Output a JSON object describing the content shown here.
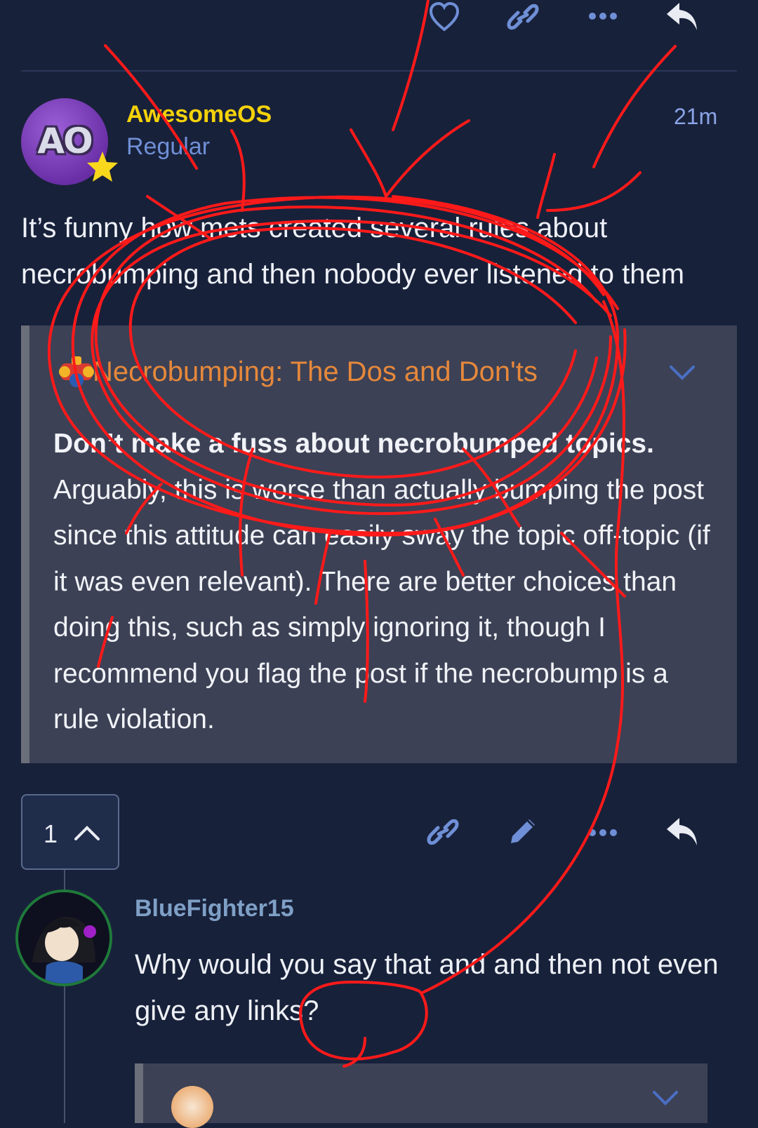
{
  "post": {
    "author": "AwesomeOS",
    "author_color": "#f4d20a",
    "avatar_initials": "AO",
    "role": "Regular",
    "time": "21m",
    "text": "It’s funny how mets created several rules about necrobumping and then nobody ever listened to them"
  },
  "quote": {
    "title": "Necrobumping: The Dos and Don'ts",
    "bold_line": "Don’t make a fuss about necrobumped topics.",
    "body": "Arguably, this is worse than actually bumping the post since this attitude can easily sway the topic off-topic (if it was even relevant). There are better choices than doing this, such as simply ignoring it, though I recommend you flag the post if the necrobump is a rule violation."
  },
  "post_actions": {
    "reply_count": "1",
    "icons": [
      "heart-icon",
      "link-icon",
      "more-icon",
      "reply-icon",
      "pencil-icon",
      "chevron-up-icon",
      "chevron-down-icon"
    ]
  },
  "reply": {
    "author": "BlueFighter15",
    "text": "Why would you say that and and then not even give any links?"
  },
  "colors": {
    "background": "#18213a",
    "accent": "#6f8fd6",
    "quote_title": "#e6883b",
    "scribble": "#ff1a1a"
  }
}
